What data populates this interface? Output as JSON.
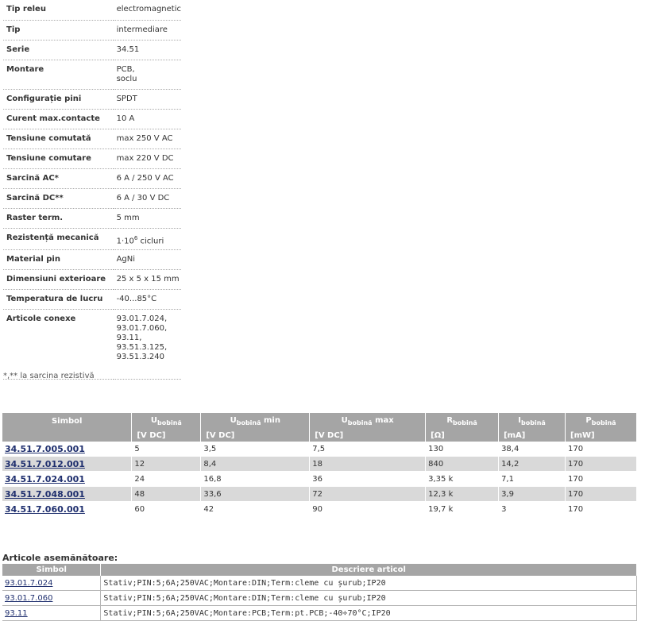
{
  "specs": [
    {
      "key": "Tip releu",
      "value": "electromagnetic"
    },
    {
      "key": "Tip",
      "value": "intermediare"
    },
    {
      "key": "Serie",
      "value": "34.51"
    },
    {
      "key": "Montare",
      "value": "PCB,\nsoclu"
    },
    {
      "key": "Configurație pini",
      "value": "SPDT"
    },
    {
      "key": "Curent max.contacte",
      "value": "10 A"
    },
    {
      "key": "Tensiune comutată",
      "value": "max 250 V AC"
    },
    {
      "key": "Tensiune comutare",
      "value": "max 220 V DC"
    },
    {
      "key": "Sarcină AC*",
      "value": "6 A / 250 V AC"
    },
    {
      "key": "Sarcină DC**",
      "value": "6 A / 30 V DC"
    },
    {
      "key": "Raster term.",
      "value": "5 mm"
    },
    {
      "key": "Rezistență mecanică",
      "value_base": "1·10",
      "value_exp": "6",
      "value_rest": " cicluri"
    },
    {
      "key": "Material pin",
      "value": "AgNi"
    },
    {
      "key": "Dimensiuni exterioare",
      "value": "25 x 5 x 15 mm"
    },
    {
      "key": "Temperatura de lucru",
      "value": "-40...85°C"
    },
    {
      "key": "Articole conexe",
      "value": "93.01.7.024,\n93.01.7.060,\n93.11,\n93.51.3.125,\n93.51.3.240"
    }
  ],
  "note": "*,** la sarcina rezistivă",
  "models": {
    "headers": [
      {
        "main": "Simbol",
        "sub": "",
        "tail": "",
        "unit": ""
      },
      {
        "main": "U",
        "sub": "bobină",
        "tail": "",
        "unit": "[V DC]"
      },
      {
        "main": "U",
        "sub": "bobină",
        "tail": " min",
        "unit": "[V DC]"
      },
      {
        "main": "U",
        "sub": "bobină",
        "tail": " max",
        "unit": "[V DC]"
      },
      {
        "main": "R",
        "sub": "bobină",
        "tail": "",
        "unit": "[Ω]"
      },
      {
        "main": "I",
        "sub": "bobină",
        "tail": "",
        "unit": "[mA]"
      },
      {
        "main": "P",
        "sub": "bobină",
        "tail": "",
        "unit": "[mW]"
      }
    ],
    "rows": [
      [
        "34.51.7.005.001",
        "5",
        "3,5",
        "7,5",
        "130",
        "38,4",
        "170"
      ],
      [
        "34.51.7.012.001",
        "12",
        "8,4",
        "18",
        "840",
        "14,2",
        "170"
      ],
      [
        "34.51.7.024.001",
        "24",
        "16,8",
        "36",
        "3,35 k",
        "7,1",
        "170"
      ],
      [
        "34.51.7.048.001",
        "48",
        "33,6",
        "72",
        "12,3 k",
        "3,9",
        "170"
      ],
      [
        "34.51.7.060.001",
        "60",
        "42",
        "90",
        "19,7 k",
        "3",
        "170"
      ]
    ]
  },
  "similar": {
    "title": "Articole asemănătoare:",
    "headers": [
      "Simbol",
      "Descriere articol"
    ],
    "rows": [
      [
        "93.01.7.024",
        "Stativ;PIN:5;6A;250VAC;Montare:DIN;Term:cleme cu șurub;IP20"
      ],
      [
        "93.01.7.060",
        "Stativ;PIN:5;6A;250VAC;Montare:DIN;Term:cleme cu șurub;IP20"
      ],
      [
        "93.11",
        "Stativ;PIN:5;6A;250VAC;Montare:PCB;Term:pt.PCB;-40÷70°C;IP20"
      ]
    ]
  },
  "colors": {
    "header_bg": "#a5a5a5",
    "alt_row": "#d9d9d9",
    "link": "#1f2f6e"
  }
}
